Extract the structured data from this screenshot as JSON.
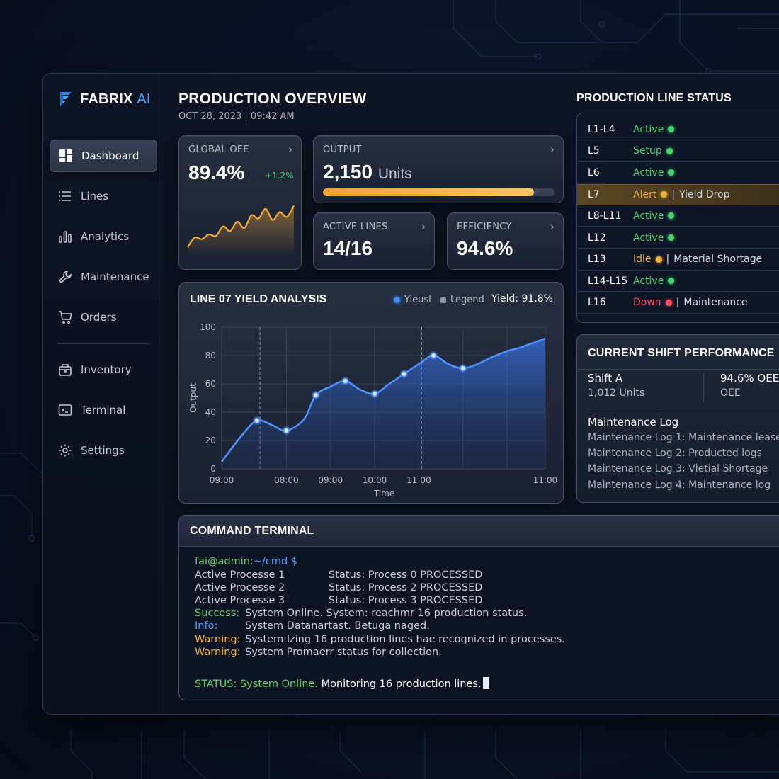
{
  "brand": {
    "name": "FABRIX",
    "suffix": "AI"
  },
  "sidebar": {
    "items": [
      {
        "label": "Dashboard",
        "icon": "dashboard-icon",
        "active": true
      },
      {
        "label": "Lines",
        "icon": "list-icon"
      },
      {
        "label": "Analytics",
        "icon": "bar-chart-icon"
      },
      {
        "label": "Maintenance",
        "icon": "wrench-icon"
      },
      {
        "label": "Orders",
        "icon": "cart-icon"
      },
      {
        "label": "Inventory",
        "icon": "box-icon"
      },
      {
        "label": "Terminal",
        "icon": "terminal-icon"
      },
      {
        "label": "Settings",
        "icon": "gear-icon"
      }
    ]
  },
  "header": {
    "title": "PRODUCTION OVERVIEW",
    "datetime": "OCT 28, 2023 | 09:42 AM"
  },
  "kpis": {
    "oee": {
      "label": "GLOBAL OEE",
      "value": "89.4%",
      "delta": "+1.2%",
      "sparkline": [
        42,
        48,
        47,
        50,
        49,
        55,
        52,
        58,
        54,
        62,
        60,
        66,
        59,
        64,
        61,
        68
      ]
    },
    "output": {
      "label": "OUTPUT",
      "value": "2,150",
      "unit": "Units",
      "progress": 0.91
    },
    "active_lines": {
      "label": "ACTIVE LINES",
      "value": "14/16"
    },
    "efficiency": {
      "label": "EFFICIENCY",
      "value": "94.6%"
    }
  },
  "yield_chart": {
    "title": "LINE 07 YIELD ANALYSIS",
    "legend_1": "Yieusl",
    "legend_2": "Legend",
    "yield_label": "Yield: 91.8%"
  },
  "chart_data": {
    "type": "area",
    "title": "LINE 07 YIELD ANALYSIS",
    "xlabel": "Time",
    "ylabel": "Output",
    "ylim": [
      0,
      100
    ],
    "yticks": [
      0,
      20,
      40,
      60,
      80,
      100
    ],
    "xticks": [
      "09:00",
      "08:00",
      "09:00",
      "10:00",
      "11:00",
      "11:00"
    ],
    "series": [
      {
        "name": "Yieusl",
        "x": [
          0,
          0.35,
          0.6,
          0.85,
          1.1,
          1.4,
          1.6,
          1.85,
          2.1,
          2.35,
          2.6,
          2.85,
          3.1,
          3.35,
          3.6,
          3.85,
          4.1,
          4.35,
          4.6,
          4.85,
          5.1,
          5.5
        ],
        "values": [
          5,
          24,
          34,
          31,
          27,
          35,
          52,
          58,
          62,
          56,
          53,
          60,
          67,
          74,
          80,
          74,
          71,
          74,
          79,
          83,
          86,
          92
        ],
        "markers": [
          2,
          4,
          6,
          8,
          10,
          12,
          14,
          16
        ]
      }
    ],
    "grid": true,
    "legend": "top-right"
  },
  "status": {
    "title": "PRODUCTION LINE STATUS",
    "rows": [
      {
        "line": "L1-L4",
        "state": "Active",
        "color": "#44d46a",
        "note": ""
      },
      {
        "line": "L5",
        "state": "Setup",
        "color": "#44d46a",
        "note": ""
      },
      {
        "line": "L6",
        "state": "Active",
        "color": "#44d46a",
        "note": ""
      },
      {
        "line": "L7",
        "state": "Alert",
        "color": "#f3b23b",
        "note": "Yield Drop",
        "alert": true
      },
      {
        "line": "L8-L11",
        "state": "Active",
        "color": "#44d46a",
        "note": ""
      },
      {
        "line": "L12",
        "state": "Active",
        "color": "#44d46a",
        "note": ""
      },
      {
        "line": "L13",
        "state": "Idle",
        "color": "#f3b23b",
        "note": "Material Shortage"
      },
      {
        "line": "L14-L15",
        "state": "Active",
        "color": "#44d46a",
        "note": ""
      },
      {
        "line": "L16",
        "state": "Down",
        "color": "#ff4d5e",
        "note": "Maintenance"
      }
    ]
  },
  "shift": {
    "title": "CURRENT SHIFT PERFORMANCE",
    "name": "Shift A",
    "units": "1,012 Units",
    "oee_value": "94.6% OEE",
    "oee_label": "OEE",
    "log_title": "Maintenance Log",
    "logs": [
      "Maintenance Log 1: Maintenance lease",
      "Maintenance Log 2: Producted logs",
      "Maintenance Log 3: Vletial Shortage",
      "Maintenance Log 4: Maintenance log"
    ]
  },
  "terminal": {
    "title": "COMMAND TERMINAL",
    "prompt_user": "fai@admin:",
    "prompt_path": "~/cmd $",
    "processes": [
      {
        "name": "Active Processe 1",
        "status": "Status: Process 0 PROCESSED"
      },
      {
        "name": "Active Processe 2",
        "status": "Status: Process 2 PROCESSED"
      },
      {
        "name": "Active Processe 3",
        "status": "Status: Process 3 PROCESSED"
      }
    ],
    "logs": [
      {
        "tag": "Success:",
        "color": "#5fd46f",
        "msg": "System Online. System: reachmr 16 production status."
      },
      {
        "tag": "Info:",
        "color": "#4aa3ff",
        "msg": "System Datanartast. Betuga naged."
      },
      {
        "tag": "Warning:",
        "color": "#f3b23b",
        "msg": "System:lzing 16 production lines hae recognized in processes."
      },
      {
        "tag": "Warning:",
        "color": "#f3b23b",
        "msg": "System Promaerr status for collection."
      }
    ],
    "status_tag": "STATUS: System Online.",
    "status_msg": "Monitoring 16 production lines."
  },
  "colors": {
    "accent": "#4aa3ff",
    "amber": "#f3b23b",
    "green": "#44d46a",
    "red": "#ff4d5e",
    "panel": "#1a2132"
  }
}
